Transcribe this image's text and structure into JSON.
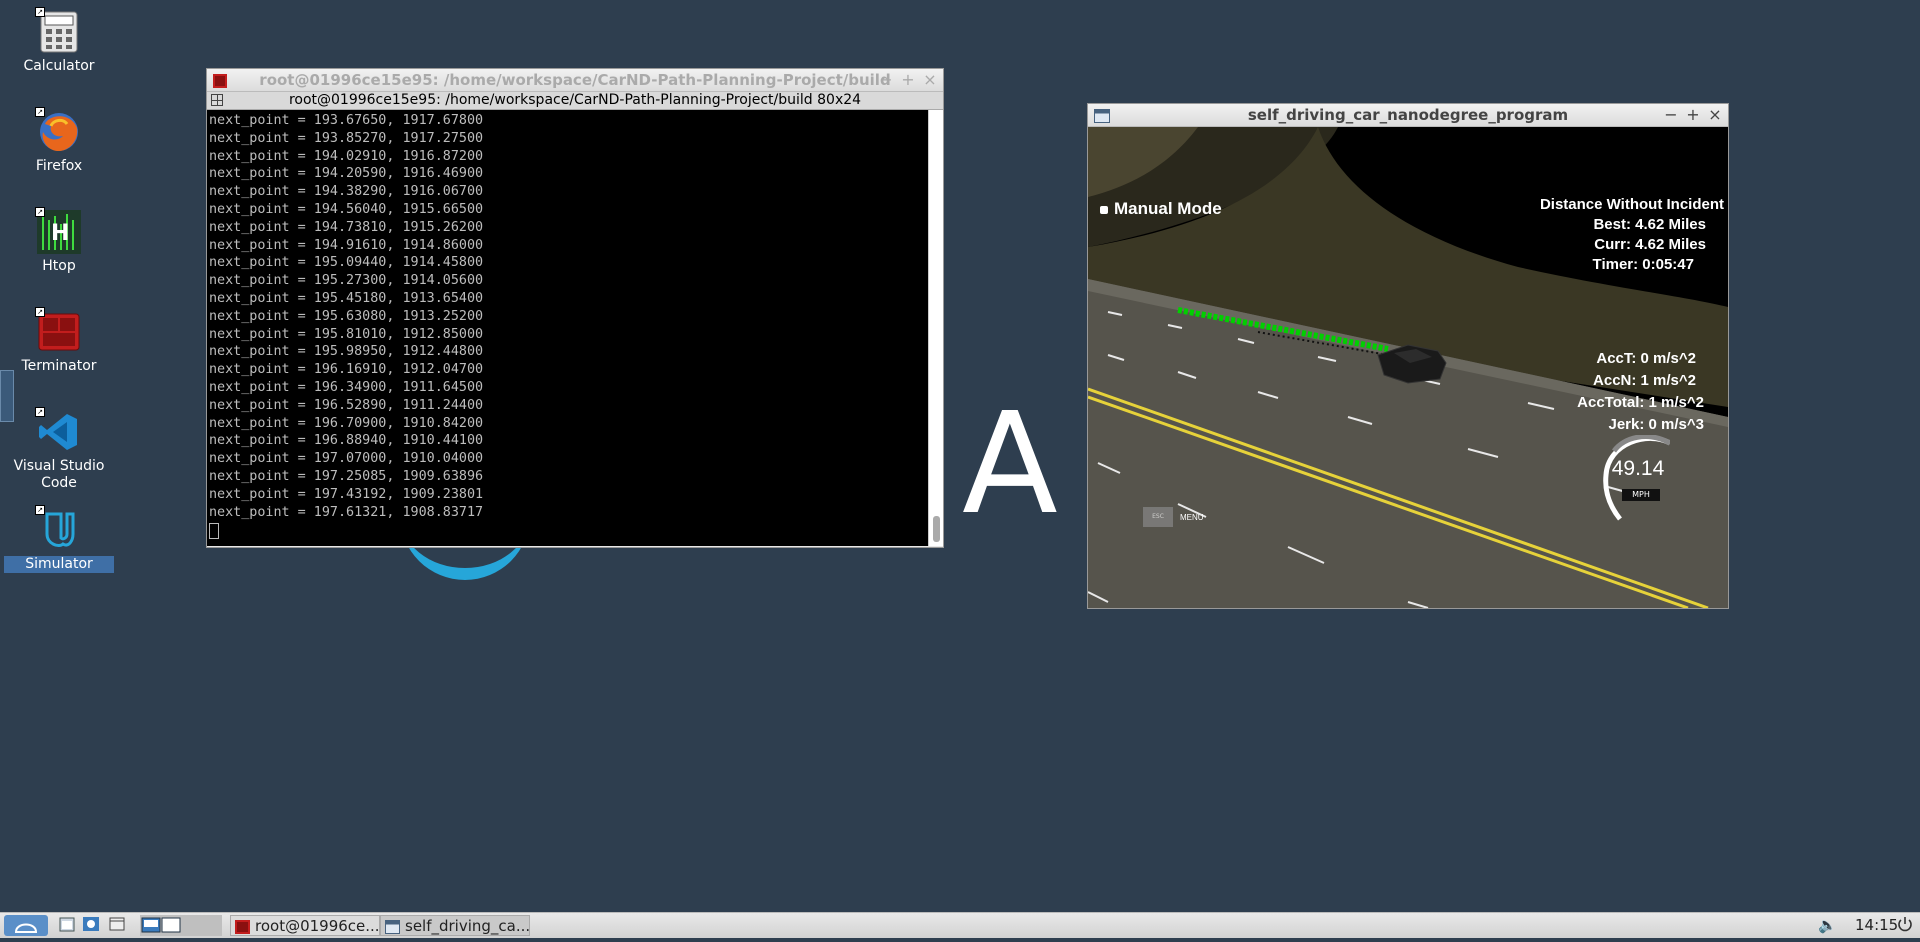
{
  "colors": {
    "desktop": "#2e3e4f",
    "accent": "#26a6d9",
    "trajectory": "#00d000"
  },
  "desktop_icons": [
    {
      "label": "Calculator",
      "icon": "calculator-icon"
    },
    {
      "label": "Firefox",
      "icon": "firefox-icon"
    },
    {
      "label": "Htop",
      "icon": "htop-icon"
    },
    {
      "label": "Terminator",
      "icon": "terminator-icon"
    },
    {
      "label": "Visual Studio Code",
      "icon": "vscode-icon"
    },
    {
      "label": "Simulator",
      "icon": "udacity-icon"
    }
  ],
  "watermark": {
    "letter": "A"
  },
  "terminal": {
    "title": "root@01996ce15e95: /home/workspace/CarND-Path-Planning-Project/build",
    "subtitle": "root@01996ce15e95: /home/workspace/CarND-Path-Planning-Project/build 80x24",
    "lines": [
      "next_point = 193.67650, 1917.67800",
      "next_point = 193.85270, 1917.27500",
      "next_point = 194.02910, 1916.87200",
      "next_point = 194.20590, 1916.46900",
      "next_point = 194.38290, 1916.06700",
      "next_point = 194.56040, 1915.66500",
      "next_point = 194.73810, 1915.26200",
      "next_point = 194.91610, 1914.86000",
      "next_point = 195.09440, 1914.45800",
      "next_point = 195.27300, 1914.05600",
      "next_point = 195.45180, 1913.65400",
      "next_point = 195.63080, 1913.25200",
      "next_point = 195.81010, 1912.85000",
      "next_point = 195.98950, 1912.44800",
      "next_point = 196.16910, 1912.04700",
      "next_point = 196.34900, 1911.64500",
      "next_point = 196.52890, 1911.24400",
      "next_point = 196.70900, 1910.84200",
      "next_point = 196.88940, 1910.44100",
      "next_point = 197.07000, 1910.04000",
      "next_point = 197.25085, 1909.63896",
      "next_point = 197.43192, 1909.23801",
      "next_point = 197.61321, 1908.83717"
    ],
    "buttons": {
      "minimize": "−",
      "maximize": "+",
      "close": "×"
    }
  },
  "simulator": {
    "title": "self_driving_car_nanodegree_program",
    "mode": "Manual Mode",
    "distance_heading": "Distance Without Incident",
    "best": "Best: 4.62 Miles",
    "curr": "Curr: 4.62 Miles",
    "timer": "Timer: 0:05:47",
    "acc_t": "AccT: 0 m/s^2",
    "acc_n": "AccN: 1 m/s^2",
    "acc_total": "AccTotal: 1 m/s^2",
    "jerk": "Jerk: 0 m/s^3",
    "speed": "49.14",
    "speed_unit": "MPH",
    "menu_label": "MENU",
    "buttons": {
      "minimize": "−",
      "maximize": "+",
      "close": "×"
    }
  },
  "taskbar": {
    "tasks": [
      {
        "label": "root@01996ce...",
        "icon": "terminator-icon"
      },
      {
        "label": "self_driving_ca...",
        "icon": "window-icon"
      }
    ],
    "clock": "14:15"
  }
}
